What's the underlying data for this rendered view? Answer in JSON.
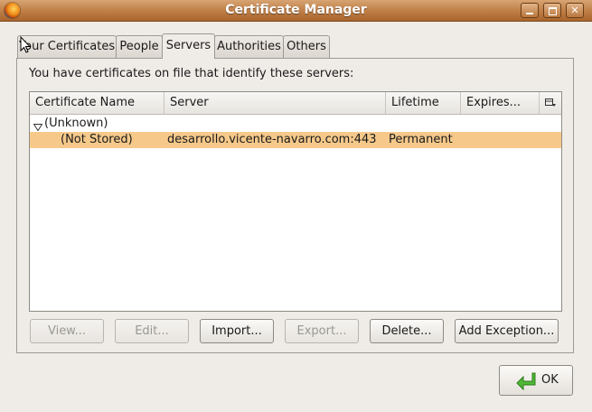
{
  "window": {
    "title": "Certificate Manager"
  },
  "tabs": [
    {
      "label": "Your Certificates"
    },
    {
      "label": "People"
    },
    {
      "label": "Servers"
    },
    {
      "label": "Authorities"
    },
    {
      "label": "Others"
    }
  ],
  "active_tab": "Servers",
  "panel": {
    "description": "You have certificates on file that identify these servers:",
    "columns": [
      "Certificate Name",
      "Server",
      "Lifetime",
      "Expires..."
    ],
    "groups": [
      {
        "name": "(Unknown)",
        "rows": [
          {
            "name": "(Not Stored)",
            "server": "desarrollo.vicente-navarro.com:443",
            "lifetime": "Permanent",
            "expires": ""
          }
        ]
      }
    ]
  },
  "buttons": {
    "view": "View...",
    "edit": "Edit...",
    "import": "Import...",
    "export": "Export...",
    "delete": "Delete...",
    "add_exception": "Add Exception...",
    "ok": "OK"
  },
  "colors": {
    "titlebar": "#c2834c",
    "selected_row": "#f6c98b",
    "ok_icon": "#3aa12a"
  },
  "icons": {
    "app": "firefox-icon",
    "column_picker": "column-picker-icon",
    "ok": "green-arrow-icon"
  }
}
